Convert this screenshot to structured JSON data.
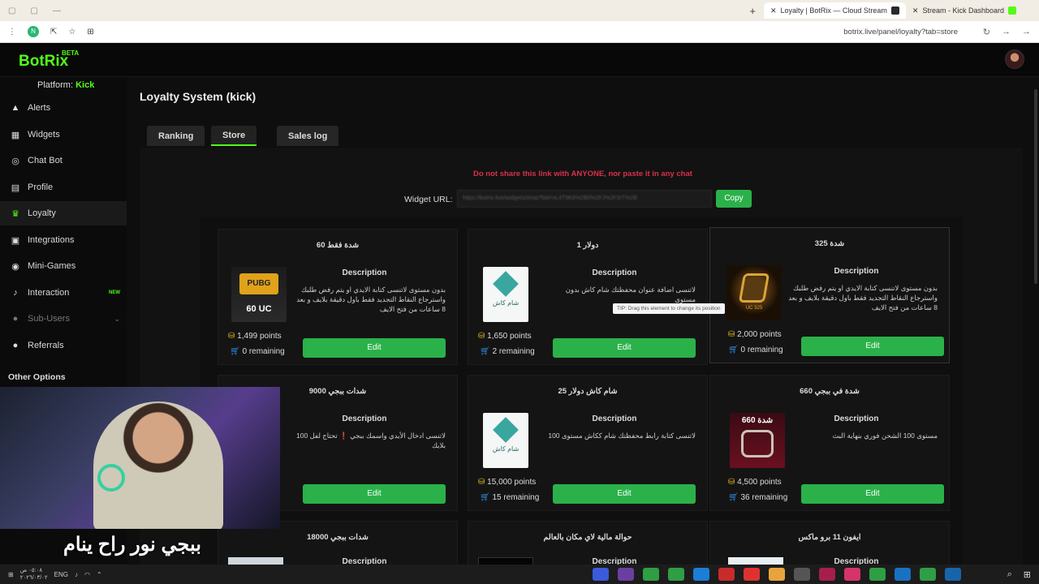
{
  "browser": {
    "tabs": [
      {
        "title": "Loyalty | BotRix — Cloud Stream",
        "active": true
      },
      {
        "title": "Stream - Kick Dashboard",
        "active": false
      }
    ],
    "new_tab_symbol": "+",
    "url": "botrix.live/panel/loyalty?tab=store",
    "profile_letter": "N"
  },
  "app": {
    "logo": "BotRix",
    "beta": "BETA",
    "accent": "#53fc18",
    "platform_label": "Platform:",
    "platform_value": "Kick"
  },
  "sidebar": {
    "items": [
      {
        "label": "Alerts",
        "icon": "warning-icon",
        "glyph": "▲"
      },
      {
        "label": "Widgets",
        "icon": "grid-icon",
        "glyph": "▦"
      },
      {
        "label": "Chat Bot",
        "icon": "robot-icon",
        "glyph": "◎"
      },
      {
        "label": "Profile",
        "icon": "id-card-icon",
        "glyph": "▤"
      },
      {
        "label": "Loyalty",
        "icon": "trophy-icon",
        "glyph": "♛"
      },
      {
        "label": "Integrations",
        "icon": "puzzle-icon",
        "glyph": "▣"
      },
      {
        "label": "Mini-Games",
        "icon": "gamepad-icon",
        "glyph": "◉"
      },
      {
        "label": "Interaction",
        "icon": "music-icon",
        "glyph": "♪",
        "badge": "NEW"
      },
      {
        "label": "Sub-Users",
        "icon": "users-icon",
        "glyph": "●"
      },
      {
        "label": "Referrals",
        "icon": "user-plus-icon",
        "glyph": "●"
      }
    ],
    "other_options": "Other Options"
  },
  "main": {
    "title": "Loyalty System (kick)",
    "tabs": [
      "Ranking",
      "Store",
      "Sales log"
    ],
    "active_tab": "Store",
    "warning": "Do not share this link with ANYONE, nor paste it in any chat",
    "widget_label": "Widget URL:",
    "widget_value": "https://botrix.live/widgets/shop?bid=xL4T9K6%2B0%2FJ%2F3rT%2B",
    "copy_label": "Copy",
    "description_label": "Description",
    "edit_label": "Edit",
    "tip": "TIP: Drag this element to change its position"
  },
  "store": [
    {
      "title": "60 شدة فقط",
      "desc": "بدون مستوى لاتنسى كتابة الايدي او يتم رفض طلبك واسترجاع النقاط التجديد فقط باول دقيقة بلايف و بعد 8 ساعات من فتح الايف",
      "points": "1,499 points",
      "remaining": "0 remaining",
      "thumb": "pubg",
      "thumb_text": "60 UC"
    },
    {
      "title": "1 دولار",
      "desc": "لاتنسى اضافة عنوان محفظتك شام كاش بدون مستوى",
      "points": "1,650 points",
      "remaining": "2 remaining",
      "thumb": "shamcash",
      "thumb_text": "شام كاش"
    },
    {
      "title": "325 شدة",
      "desc": "بدون مستوى لاتنسى كتابة الايدي او يتم رفض طلبك واسترجاع النقاط التجديد فقط باول دقيقة بلايف و بعد 8 ساعات من فتح الايف",
      "points": "2,000 points",
      "remaining": "0 remaining",
      "thumb": "uc325",
      "thumb_text": "UC 325"
    },
    {
      "title": "9000 شدات ببجي",
      "desc": "لاتنسى ادخال الأيدي واسمك ببجي ❗ تحتاج لفل 100 بلايك",
      "points": "",
      "remaining": "",
      "thumb": "hidden",
      "thumb_text": ""
    },
    {
      "title": "25 شام كاش دولار",
      "desc": "لاتنسى كتابة رابط محفظتك شام ككاش مستوى 100",
      "points": "15,000 points",
      "remaining": "15 remaining",
      "thumb": "shamcash",
      "thumb_text": "شام كاش"
    },
    {
      "title": "660 شدة في ببجي",
      "desc": "مستوى 100 الشحن فوري بنهاية البث",
      "points": "4,500 points",
      "remaining": "36 remaining",
      "thumb": "uc660",
      "thumb_text": "660 شدة"
    },
    {
      "title": "18000 شدات ببجي",
      "desc": "",
      "points": "",
      "remaining": "",
      "thumb": "partial",
      "thumb_text": ""
    },
    {
      "title": "حوالة مالية لاي مكان بالعالم",
      "desc": "",
      "points": "",
      "remaining": "",
      "thumb": "partial",
      "thumb_text": ""
    },
    {
      "title": "ايفون 11 برو ماكس",
      "desc": "",
      "points": "",
      "remaining": "",
      "thumb": "partial",
      "thumb_text": ""
    }
  ],
  "overlay": {
    "caption": "ببجي نور راح ينام"
  },
  "taskbar": {
    "lang": "ENG",
    "time": "٠٥:٠٨ ص",
    "date": "٢٠٢٦/٠٣/٠٢"
  }
}
